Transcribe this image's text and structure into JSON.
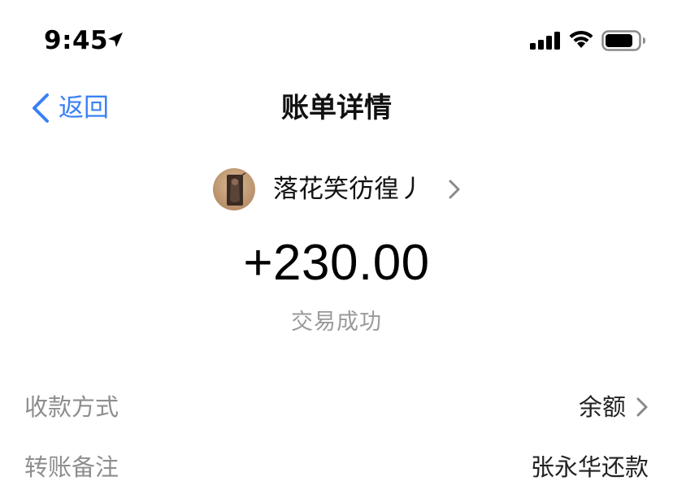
{
  "status_bar": {
    "time": "9:45",
    "icons": [
      "location-arrow-icon",
      "cellular-signal-icon",
      "wifi-icon",
      "battery-icon"
    ]
  },
  "nav": {
    "back_label": "返回",
    "title": "账单详情",
    "accent_color": "#3a80f5"
  },
  "payer": {
    "name": "落花笑彷徨丿"
  },
  "transaction": {
    "amount": "+230.00",
    "status": "交易成功"
  },
  "details": {
    "method": {
      "label": "收款方式",
      "value": "余额"
    },
    "remark": {
      "label": "转账备注",
      "value": "张永华还款"
    }
  }
}
